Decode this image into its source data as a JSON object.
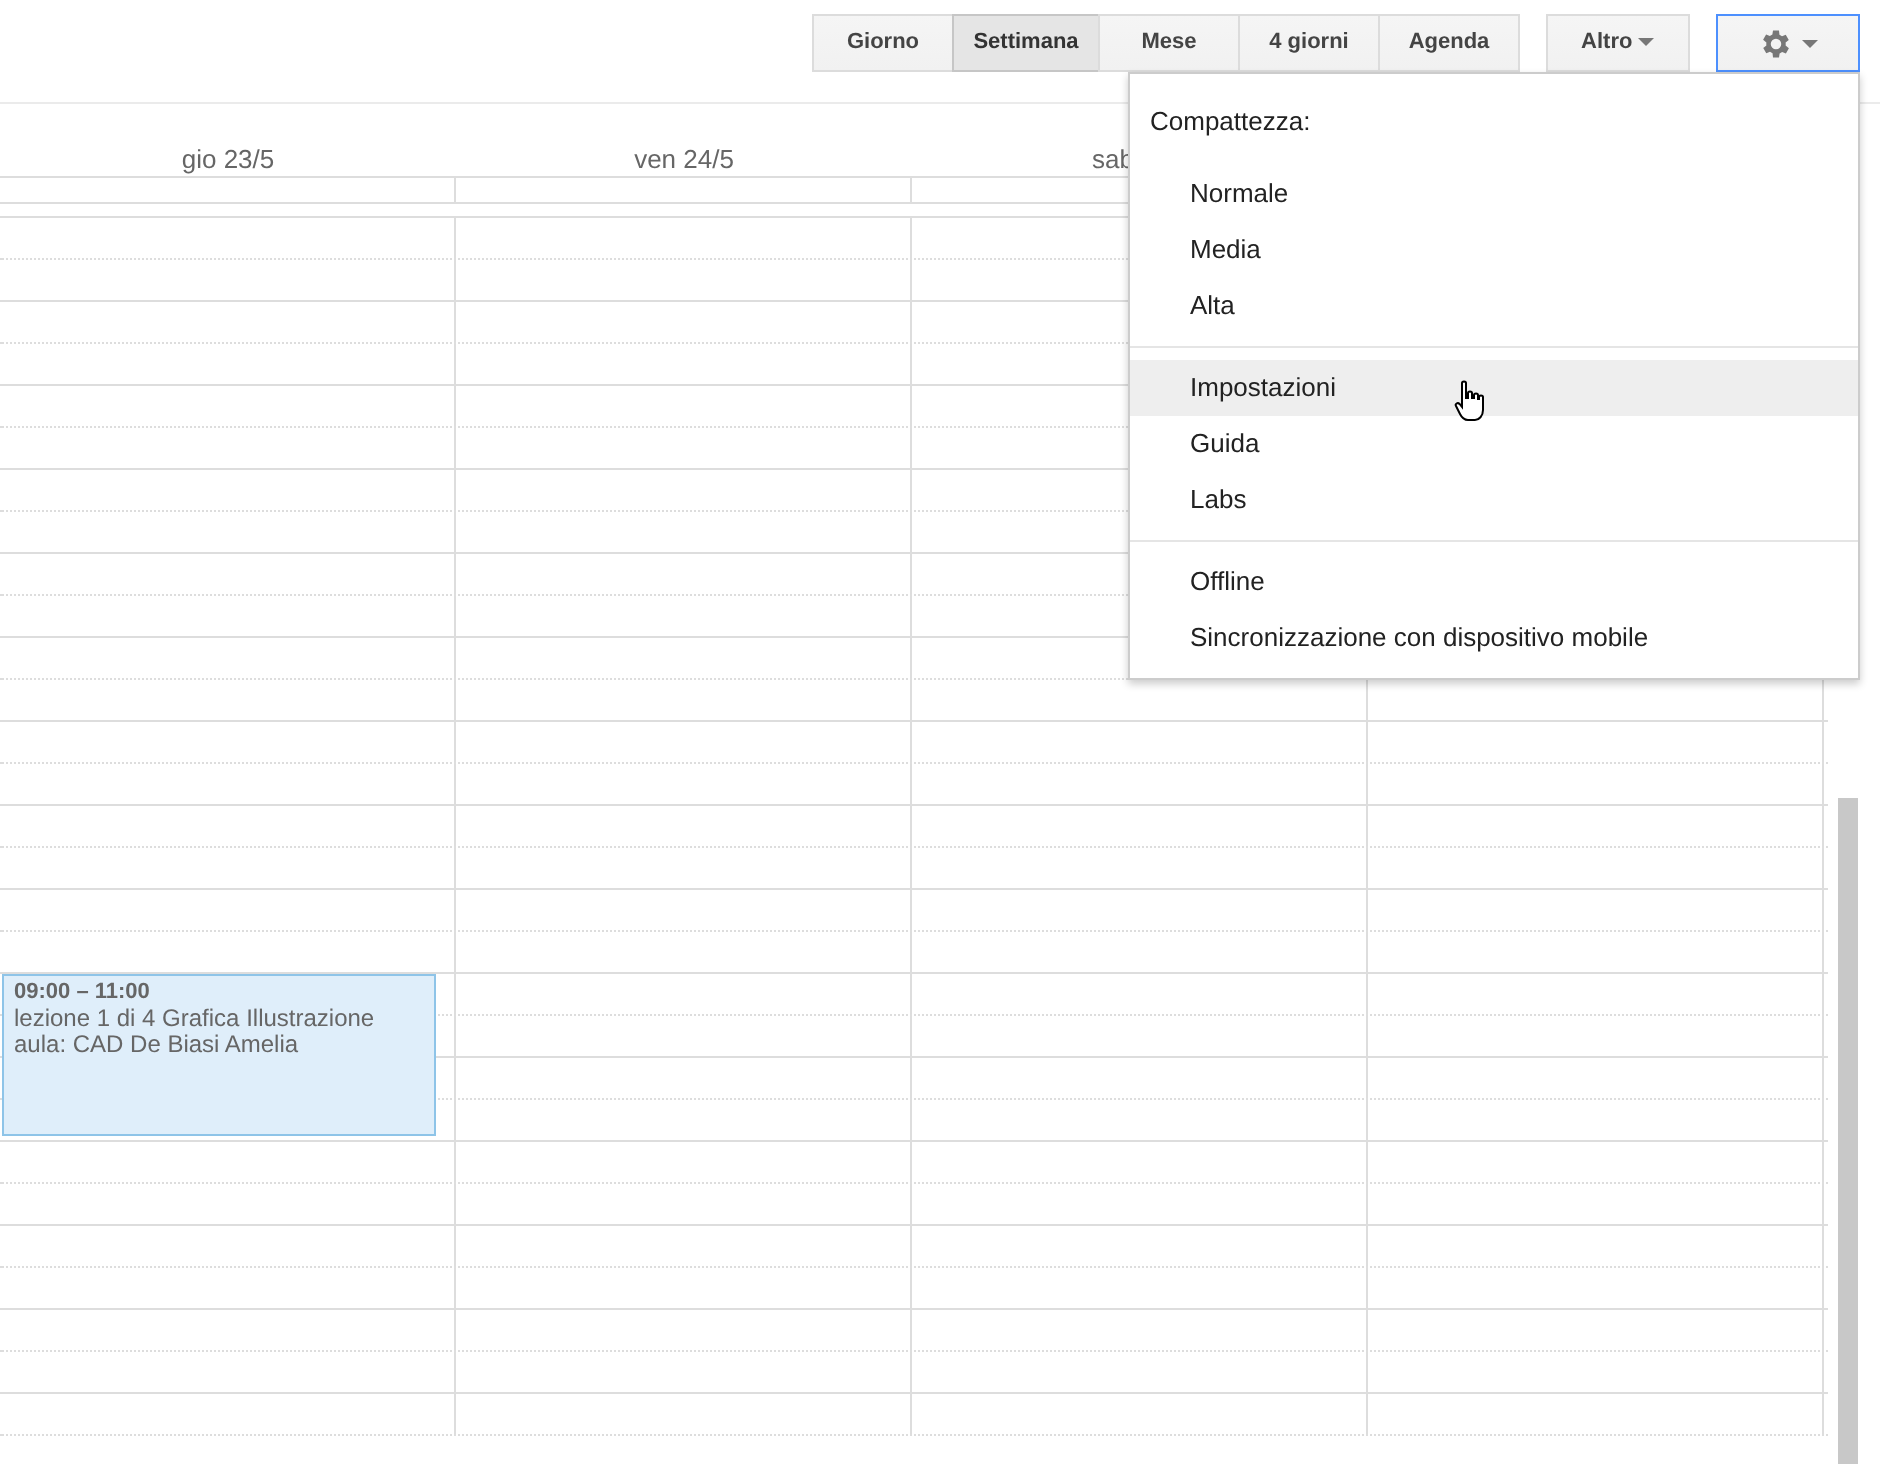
{
  "toolbar": {
    "views": [
      {
        "label": "Giorno",
        "selected": false
      },
      {
        "label": "Settimana",
        "selected": true
      },
      {
        "label": "Mese",
        "selected": false
      },
      {
        "label": "4 giorni",
        "selected": false
      },
      {
        "label": "Agenda",
        "selected": false
      }
    ],
    "more_button": {
      "label": "Altro"
    },
    "settings_button": {
      "open": true
    }
  },
  "day_headers": [
    "gio 23/5",
    "ven 24/5",
    "sab"
  ],
  "event": {
    "time": "09:00 – 11:00",
    "lines": [
      "lezione 1 di 4 Grafica Illustrazione",
      "aula: CAD De Biasi Amelia"
    ]
  },
  "settings_menu": {
    "heading": "Compattezza:",
    "sections": [
      [
        {
          "label": "Normale",
          "hovered": false
        },
        {
          "label": "Media",
          "hovered": false
        },
        {
          "label": "Alta",
          "hovered": false
        }
      ],
      [
        {
          "label": "Impostazioni",
          "hovered": true
        },
        {
          "label": "Guida",
          "hovered": false
        },
        {
          "label": "Labs",
          "hovered": false
        }
      ],
      [
        {
          "label": "Offline",
          "hovered": false
        },
        {
          "label": "Sincronizzazione con dispositivo mobile",
          "hovered": false
        }
      ]
    ]
  }
}
